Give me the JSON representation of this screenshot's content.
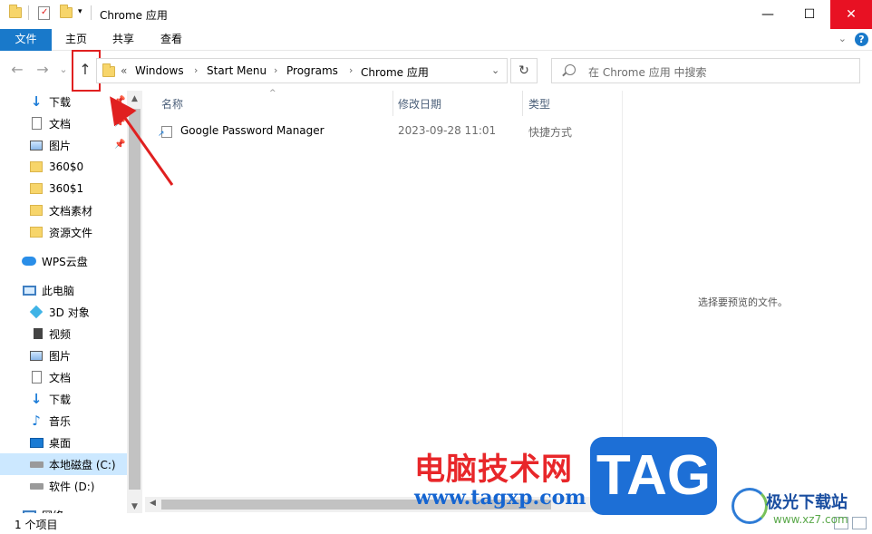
{
  "window": {
    "title": "Chrome 应用",
    "controls": {
      "minimize": "—",
      "maximize": "☐",
      "close": "✕"
    }
  },
  "ribbon": {
    "tabs": [
      "文件",
      "主页",
      "共享",
      "查看"
    ],
    "help": "?",
    "expand": "⌄"
  },
  "nav": {
    "back": "←",
    "forward": "→",
    "recent": "⌄",
    "up": "↑"
  },
  "address": {
    "overflow": "«",
    "crumbs": [
      "Windows",
      "Start Menu",
      "Programs",
      "Chrome 应用"
    ],
    "separator": "›",
    "dropdown": "⌄",
    "refresh": "↻"
  },
  "search": {
    "placeholder": "在 Chrome 应用 中搜索"
  },
  "sidebar": {
    "items": [
      {
        "label": "下载",
        "icon": "download-icon",
        "pinned": true
      },
      {
        "label": "文档",
        "icon": "document-icon",
        "pinned": true
      },
      {
        "label": "图片",
        "icon": "pictures-icon",
        "pinned": true
      },
      {
        "label": "360$0",
        "icon": "folder-icon"
      },
      {
        "label": "360$1",
        "icon": "folder-icon"
      },
      {
        "label": "文档素材",
        "icon": "folder-icon"
      },
      {
        "label": "资源文件",
        "icon": "folder-icon"
      },
      {
        "label": "WPS云盘",
        "icon": "cloud-icon"
      },
      {
        "label": "此电脑",
        "icon": "computer-icon"
      },
      {
        "label": "3D 对象",
        "icon": "3d-objects-icon"
      },
      {
        "label": "视频",
        "icon": "video-icon"
      },
      {
        "label": "图片",
        "icon": "pictures-icon"
      },
      {
        "label": "文档",
        "icon": "document-icon"
      },
      {
        "label": "下载",
        "icon": "download-icon"
      },
      {
        "label": "音乐",
        "icon": "music-icon"
      },
      {
        "label": "桌面",
        "icon": "desktop-icon"
      },
      {
        "label": "本地磁盘 (C:)",
        "icon": "drive-icon",
        "selected": true
      },
      {
        "label": "软件 (D:)",
        "icon": "drive-icon"
      },
      {
        "label": "网络",
        "icon": "network-icon"
      }
    ]
  },
  "columns": {
    "name": "名称",
    "modified": "修改日期",
    "type": "类型"
  },
  "files": [
    {
      "name": "Google Password Manager",
      "modified": "2023-09-28 11:01",
      "type": "快捷方式"
    }
  ],
  "preview": {
    "empty_text": "选择要预览的文件。"
  },
  "status": {
    "count": "1 个项目"
  },
  "watermark": {
    "site_cn": "电脑技术网",
    "site_url": "www.tagxp.com",
    "tag": "TAG",
    "brand": "极光下载站",
    "brand_url": "www.xz7.com"
  },
  "colors": {
    "accent": "#1979ca",
    "highlight": "#e02020",
    "selected": "#cce8ff"
  }
}
